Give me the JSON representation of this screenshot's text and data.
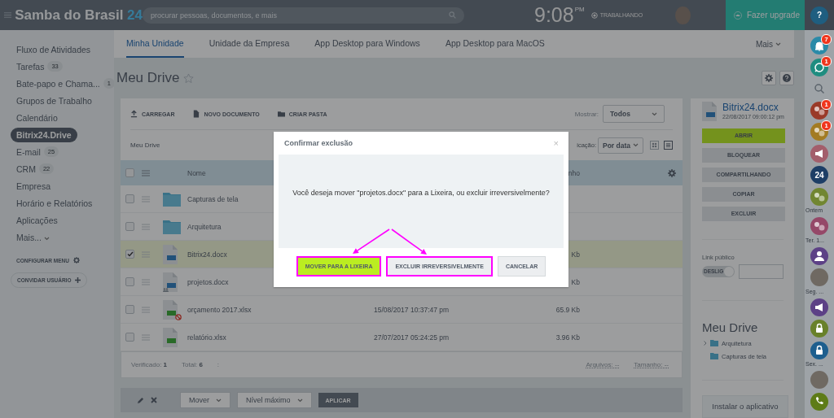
{
  "topbar": {
    "logo": "Samba do Brasil",
    "logo_suffix": "24",
    "search": {
      "placeholder": "procurar pessoas, documentos, e mais"
    },
    "clock": "9:08",
    "clock_period": "PM",
    "status": "TRABALHANDO",
    "upgrade": "Fazer upgrade"
  },
  "sidebar": {
    "items": [
      {
        "label": "Fluxo de Atividades",
        "selected": false,
        "dropdown": false
      },
      {
        "label": "Tarefas",
        "counter": "33",
        "selected": false,
        "dropdown": false
      },
      {
        "label": "Bate-papo e Chama...",
        "counter": "1",
        "selected": false,
        "dropdown": false
      },
      {
        "label": "Grupos de Trabalho",
        "selected": false,
        "dropdown": false
      },
      {
        "label": "Calendário",
        "selected": false,
        "dropdown": false
      },
      {
        "label": "Bitrix24.Drive",
        "selected": true,
        "dropdown": false
      },
      {
        "label": "E-mail",
        "counter": "25",
        "selected": false,
        "dropdown": false
      },
      {
        "label": "CRM",
        "counter": "22",
        "selected": false,
        "dropdown": false
      },
      {
        "label": "Empresa",
        "selected": false,
        "dropdown": false
      },
      {
        "label": "Horário e Relatórios",
        "selected": false,
        "dropdown": false
      },
      {
        "label": "Aplicações",
        "selected": false,
        "dropdown": false
      },
      {
        "label": "Mais...",
        "selected": false,
        "dropdown": true
      }
    ],
    "configure": "CONFIGURAR MENU",
    "invite": "CONVIDAR USUÁRIO"
  },
  "tabs": [
    {
      "label": "Minha Unidade",
      "selected": true
    },
    {
      "label": "Unidade da Empresa",
      "selected": false
    },
    {
      "label": "App Desktop para Windows",
      "selected": false
    },
    {
      "label": "App Desktop para MacOS",
      "selected": false
    }
  ],
  "tabs_more": "Mais",
  "page": {
    "title": "Meu Drive",
    "favorite": false
  },
  "toolbar": {
    "actions": [
      {
        "kind": "upload",
        "label": "CARREGAR"
      },
      {
        "kind": "new-doc",
        "label": "NOVO DOCUMENTO"
      },
      {
        "kind": "new-folder",
        "label": "CRIAR PASTA"
      }
    ],
    "show_label": "Mostrar:",
    "show_value": "Todos"
  },
  "breadcrumb": "Meu Drive",
  "sort_label": "icação:",
  "sort_value": "Por data",
  "views": [
    {
      "kind": "grid",
      "selected": false
    },
    {
      "kind": "list",
      "selected": true
    }
  ],
  "table": {
    "header_checked": false,
    "columns": [
      {
        "label": "Nome"
      },
      {
        "label": "nho"
      }
    ],
    "rows": [
      {
        "name": "Capturas de tela",
        "kind": "folder",
        "checked": false,
        "selected": false,
        "shared": false,
        "blocked": false
      },
      {
        "name": "Arquitetura",
        "kind": "folder",
        "checked": false,
        "selected": false,
        "shared": false,
        "blocked": false
      },
      {
        "name": "Bitrix24.docx",
        "kind": "docx",
        "size": "Kb",
        "checked": true,
        "selected": true,
        "shared": false,
        "blocked": false
      },
      {
        "name": "projetos.docx",
        "kind": "docx",
        "size": "Kb",
        "checked": false,
        "selected": false,
        "shared": true,
        "blocked": false
      },
      {
        "name": "orçamento 2017.xlsx",
        "kind": "xlsx",
        "modified": "15/08/2017 10:37:47 pm",
        "size": "65.9 Kb",
        "checked": false,
        "selected": false,
        "shared": false,
        "blocked": true
      },
      {
        "name": "relatório.xlsx",
        "kind": "xlsx",
        "modified": "27/07/2017 05:24:25 pm",
        "size": "3.96 Kb",
        "checked": false,
        "selected": false,
        "shared": false,
        "blocked": false
      }
    ],
    "footer": {
      "checked": "Verificado: **1**",
      "total": "Total: **6**",
      "separator": ":",
      "files": "Arquivos: --",
      "size": "Tamanho: --"
    }
  },
  "bulk_actions": {
    "move": "Mover",
    "access": "Nível máximo",
    "apply": "APLICAR"
  },
  "panel": {
    "file_name": "Bitrix24.docx",
    "file_date": "22/08/2017 09:00:12 pm",
    "buttons": [
      {
        "label": "ABRIR",
        "kind": "primary"
      },
      {
        "label": "BLOQUEAR",
        "kind": "secondary"
      },
      {
        "label": "COMPARTILHANDO",
        "kind": "secondary"
      },
      {
        "label": "COPIAR",
        "kind": "secondary"
      },
      {
        "label": "EXCLUIR",
        "kind": "secondary"
      }
    ],
    "public_link": {
      "label": "Link público",
      "toggle": "DESLIG",
      "on": false
    },
    "tree_title": "Meu Drive",
    "tree": [
      {
        "label": "Arquitetura",
        "has_children": true
      },
      {
        "label": "Capturas de tela",
        "has_children": false
      }
    ],
    "install": "Instalar o aplicativo"
  },
  "right_strip": {
    "help": "?",
    "items": [
      {
        "kind": "bell",
        "color": "#2a8aa8",
        "badge": "7"
      },
      {
        "kind": "chat",
        "color": "#1f8d80",
        "badge": "1"
      },
      {
        "kind": "search"
      },
      {
        "kind": "group",
        "color": "#9a3a28",
        "badge": "1"
      },
      {
        "kind": "group",
        "color": "#a37b22",
        "badge": "1"
      },
      {
        "kind": "megaphone",
        "color": "#a35e6b"
      },
      {
        "kind": "logo",
        "color": "#1d3e66",
        "text": "24"
      },
      {
        "kind": "group",
        "color": "#718631"
      },
      {
        "kind": "label",
        "text": "Ontem"
      },
      {
        "kind": "group",
        "color": "#954868"
      },
      {
        "kind": "label",
        "text": "Ter. 1..."
      },
      {
        "kind": "user",
        "color": "#5d4186"
      },
      {
        "kind": "photo"
      },
      {
        "kind": "label",
        "text": "Seg. ..."
      },
      {
        "kind": "megaphone",
        "color": "#5d4186"
      },
      {
        "kind": "lock",
        "color": "#69812a"
      },
      {
        "kind": "lock",
        "color": "#1e5f8e"
      },
      {
        "kind": "label",
        "text": "Sex. ..."
      },
      {
        "kind": "photo"
      },
      {
        "kind": "phone",
        "color": "#5e7c18"
      }
    ]
  },
  "dialog": {
    "title": "Confirmar exclusão",
    "close": "×",
    "message": "Você deseja mover \"projetos.docx\" para a Lixeira, ou excluir irreversivelmente?",
    "buttons": [
      {
        "label": "MOVER PARA A LIXEIRA",
        "kind": "primary",
        "highlighted": true
      },
      {
        "label": "EXCLUIR IRREVERSIVELMENTE",
        "kind": "secondary",
        "highlighted": true
      },
      {
        "label": "CANCELAR",
        "kind": "secondary",
        "highlighted": false
      }
    ]
  }
}
